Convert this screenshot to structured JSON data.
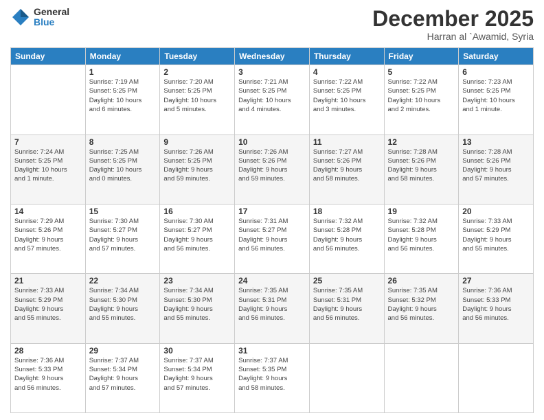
{
  "logo": {
    "general": "General",
    "blue": "Blue"
  },
  "title": "December 2025",
  "location": "Harran al `Awamid, Syria",
  "days_of_week": [
    "Sunday",
    "Monday",
    "Tuesday",
    "Wednesday",
    "Thursday",
    "Friday",
    "Saturday"
  ],
  "weeks": [
    [
      {
        "num": "",
        "info": ""
      },
      {
        "num": "1",
        "info": "Sunrise: 7:19 AM\nSunset: 5:25 PM\nDaylight: 10 hours\nand 6 minutes."
      },
      {
        "num": "2",
        "info": "Sunrise: 7:20 AM\nSunset: 5:25 PM\nDaylight: 10 hours\nand 5 minutes."
      },
      {
        "num": "3",
        "info": "Sunrise: 7:21 AM\nSunset: 5:25 PM\nDaylight: 10 hours\nand 4 minutes."
      },
      {
        "num": "4",
        "info": "Sunrise: 7:22 AM\nSunset: 5:25 PM\nDaylight: 10 hours\nand 3 minutes."
      },
      {
        "num": "5",
        "info": "Sunrise: 7:22 AM\nSunset: 5:25 PM\nDaylight: 10 hours\nand 2 minutes."
      },
      {
        "num": "6",
        "info": "Sunrise: 7:23 AM\nSunset: 5:25 PM\nDaylight: 10 hours\nand 1 minute."
      }
    ],
    [
      {
        "num": "7",
        "info": "Sunrise: 7:24 AM\nSunset: 5:25 PM\nDaylight: 10 hours\nand 1 minute."
      },
      {
        "num": "8",
        "info": "Sunrise: 7:25 AM\nSunset: 5:25 PM\nDaylight: 10 hours\nand 0 minutes."
      },
      {
        "num": "9",
        "info": "Sunrise: 7:26 AM\nSunset: 5:25 PM\nDaylight: 9 hours\nand 59 minutes."
      },
      {
        "num": "10",
        "info": "Sunrise: 7:26 AM\nSunset: 5:26 PM\nDaylight: 9 hours\nand 59 minutes."
      },
      {
        "num": "11",
        "info": "Sunrise: 7:27 AM\nSunset: 5:26 PM\nDaylight: 9 hours\nand 58 minutes."
      },
      {
        "num": "12",
        "info": "Sunrise: 7:28 AM\nSunset: 5:26 PM\nDaylight: 9 hours\nand 58 minutes."
      },
      {
        "num": "13",
        "info": "Sunrise: 7:28 AM\nSunset: 5:26 PM\nDaylight: 9 hours\nand 57 minutes."
      }
    ],
    [
      {
        "num": "14",
        "info": "Sunrise: 7:29 AM\nSunset: 5:26 PM\nDaylight: 9 hours\nand 57 minutes."
      },
      {
        "num": "15",
        "info": "Sunrise: 7:30 AM\nSunset: 5:27 PM\nDaylight: 9 hours\nand 57 minutes."
      },
      {
        "num": "16",
        "info": "Sunrise: 7:30 AM\nSunset: 5:27 PM\nDaylight: 9 hours\nand 56 minutes."
      },
      {
        "num": "17",
        "info": "Sunrise: 7:31 AM\nSunset: 5:27 PM\nDaylight: 9 hours\nand 56 minutes."
      },
      {
        "num": "18",
        "info": "Sunrise: 7:32 AM\nSunset: 5:28 PM\nDaylight: 9 hours\nand 56 minutes."
      },
      {
        "num": "19",
        "info": "Sunrise: 7:32 AM\nSunset: 5:28 PM\nDaylight: 9 hours\nand 56 minutes."
      },
      {
        "num": "20",
        "info": "Sunrise: 7:33 AM\nSunset: 5:29 PM\nDaylight: 9 hours\nand 55 minutes."
      }
    ],
    [
      {
        "num": "21",
        "info": "Sunrise: 7:33 AM\nSunset: 5:29 PM\nDaylight: 9 hours\nand 55 minutes."
      },
      {
        "num": "22",
        "info": "Sunrise: 7:34 AM\nSunset: 5:30 PM\nDaylight: 9 hours\nand 55 minutes."
      },
      {
        "num": "23",
        "info": "Sunrise: 7:34 AM\nSunset: 5:30 PM\nDaylight: 9 hours\nand 55 minutes."
      },
      {
        "num": "24",
        "info": "Sunrise: 7:35 AM\nSunset: 5:31 PM\nDaylight: 9 hours\nand 56 minutes."
      },
      {
        "num": "25",
        "info": "Sunrise: 7:35 AM\nSunset: 5:31 PM\nDaylight: 9 hours\nand 56 minutes."
      },
      {
        "num": "26",
        "info": "Sunrise: 7:35 AM\nSunset: 5:32 PM\nDaylight: 9 hours\nand 56 minutes."
      },
      {
        "num": "27",
        "info": "Sunrise: 7:36 AM\nSunset: 5:33 PM\nDaylight: 9 hours\nand 56 minutes."
      }
    ],
    [
      {
        "num": "28",
        "info": "Sunrise: 7:36 AM\nSunset: 5:33 PM\nDaylight: 9 hours\nand 56 minutes."
      },
      {
        "num": "29",
        "info": "Sunrise: 7:37 AM\nSunset: 5:34 PM\nDaylight: 9 hours\nand 57 minutes."
      },
      {
        "num": "30",
        "info": "Sunrise: 7:37 AM\nSunset: 5:34 PM\nDaylight: 9 hours\nand 57 minutes."
      },
      {
        "num": "31",
        "info": "Sunrise: 7:37 AM\nSunset: 5:35 PM\nDaylight: 9 hours\nand 58 minutes."
      },
      {
        "num": "",
        "info": ""
      },
      {
        "num": "",
        "info": ""
      },
      {
        "num": "",
        "info": ""
      }
    ]
  ]
}
